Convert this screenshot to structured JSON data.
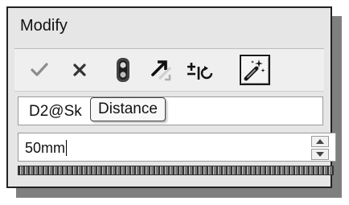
{
  "dialog": {
    "title": "Modify"
  },
  "toolbar": {
    "buttons": [
      {
        "icon": "check-icon",
        "label": "OK"
      },
      {
        "icon": "close-icon",
        "label": "Cancel"
      },
      {
        "icon": "rebuild-icon",
        "label": "Rebuild"
      },
      {
        "icon": "reset-spin-icon",
        "label": "Reset spin value"
      },
      {
        "icon": "mark-dimension-icon",
        "label": "Mark dimension"
      },
      {
        "icon": "wand-icon",
        "label": "Smart dimension",
        "active": true
      }
    ]
  },
  "name_field": {
    "value": "D2@Sk"
  },
  "tooltip": {
    "text": "Distance"
  },
  "value_field": {
    "value": "50mm"
  },
  "colors": {
    "dialog_bg": "#e6e6e6",
    "border": "#222222",
    "shadow": "#7f7f7f"
  }
}
